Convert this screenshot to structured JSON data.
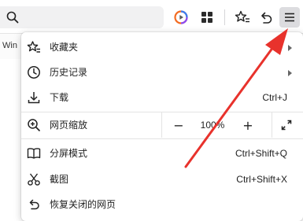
{
  "toolbar": {
    "search_icon": "search-icon",
    "media_icon": "media-play-icon",
    "apps_icon": "apps-grid-icon",
    "favorites_icon": "star-list-icon",
    "back_icon": "undo-back-icon",
    "menu_icon": "hamburger-menu-icon"
  },
  "page": {
    "tab_text": "Win"
  },
  "menu": {
    "items": [
      {
        "label": "收藏夹",
        "icon": "favorites-star-icon",
        "submenu": true
      },
      {
        "label": "历史记录",
        "icon": "history-clock-icon",
        "submenu": true
      },
      {
        "label": "下载",
        "icon": "download-icon",
        "shortcut": "Ctrl+J"
      },
      {
        "label": "网页缩放",
        "icon": "zoom-magnifier-icon"
      },
      {
        "label": "分屏模式",
        "icon": "split-screen-icon",
        "shortcut": "Ctrl+Shift+Q"
      },
      {
        "label": "截图",
        "icon": "scissors-icon",
        "shortcut": "Ctrl+Shift+X"
      },
      {
        "label": "恢复关闭的网页",
        "icon": "restore-page-icon"
      }
    ],
    "zoom": {
      "minus": "−",
      "value": "100%",
      "plus": "+",
      "fullscreen_icon": "fullscreen-icon"
    }
  },
  "annotation": {
    "color": "#e8322c",
    "target": "menu-button"
  }
}
